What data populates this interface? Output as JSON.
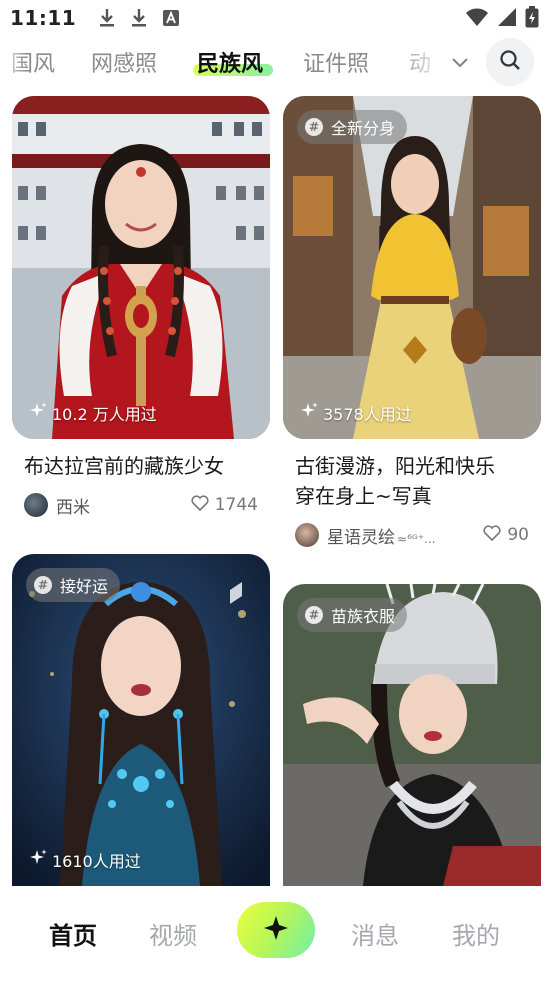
{
  "status_bar": {
    "time": "11:11",
    "left_icons": [
      "download-icon",
      "download-icon",
      "a-icon"
    ],
    "right_icons": [
      "wifi-icon",
      "signal-icon",
      "battery-icon"
    ]
  },
  "tabs": {
    "items": [
      {
        "label": "国风",
        "active": false
      },
      {
        "label": "网感照",
        "active": false
      },
      {
        "label": "民族风",
        "active": true
      },
      {
        "label": "证件照",
        "active": false
      },
      {
        "label": "动",
        "active": false
      }
    ],
    "highlight_color": "#d9ff59",
    "more_icon": "chevron-down-icon",
    "search_icon": "search-icon"
  },
  "cards": [
    {
      "title": "布达拉宫前的藏族少女",
      "usage": "10.2 万人用过",
      "author": "西米",
      "likes": "1744"
    },
    {
      "tag": "全新分身",
      "title_line1": "古街漫游，阳光和快乐",
      "title_line2": "穿在身上~写真",
      "usage": "3578人用过",
      "author": "星语灵绘",
      "author_suffix": "⁶ᴳ⁺...",
      "likes": "90"
    },
    {
      "tag": "接好运",
      "usage": "1610人用过"
    },
    {
      "tag": "苗族衣服"
    }
  ],
  "bottom_nav": {
    "items": [
      {
        "label": "首页",
        "active": true
      },
      {
        "label": "视频",
        "active": false
      },
      {
        "label": "消息",
        "active": false
      },
      {
        "label": "我的",
        "active": false
      }
    ],
    "create_icon": "sparkle-icon"
  }
}
